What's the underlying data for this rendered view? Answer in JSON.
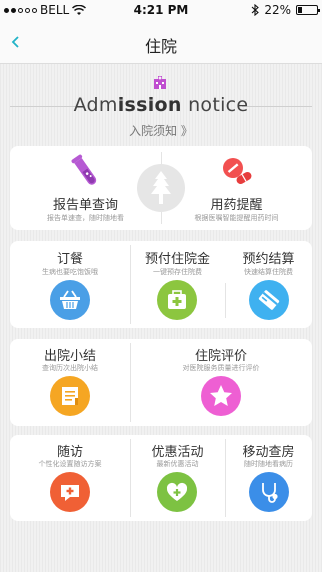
{
  "status_bar": {
    "carrier": "BELL",
    "time": "4:21 PM",
    "battery": "22%",
    "battery_level": 0.22
  },
  "nav": {
    "title": "住院"
  },
  "admission": {
    "title_light": "Adm",
    "title_bold": "ission",
    "title_tail": " notice",
    "subtitle": "入院须知 》"
  },
  "top_card": {
    "left": {
      "title": "报告单查询",
      "subtitle": "报告单速查，随时随地看"
    },
    "right": {
      "title": "用药提醒",
      "subtitle": "根据医嘱智能提醒用药时间"
    }
  },
  "row1": [
    {
      "title": "订餐",
      "subtitle": "生病也要吃饱饭哦",
      "color": "#4a9fe6",
      "icon": "basket-icon"
    },
    {
      "title": "预付住院金",
      "subtitle": "一键预存住院费",
      "color": "#8cc63f",
      "icon": "medkit-icon"
    },
    {
      "title": "预约结算",
      "subtitle": "快速结算住院费",
      "color": "#3fb1f0",
      "icon": "card-icon"
    }
  ],
  "row2": [
    {
      "title": "出院小结",
      "subtitle": "查询历次出院小结",
      "color": "#f5a623",
      "icon": "document-icon"
    },
    {
      "title": "住院评价",
      "subtitle": "对医院服务质量进行评价",
      "color": "#ee5fd3",
      "icon": "star-icon"
    }
  ],
  "row3": [
    {
      "title": "随访",
      "subtitle": "个性化设置随访方案",
      "color": "#f06035",
      "icon": "chat-plus-icon"
    },
    {
      "title": "优惠活动",
      "subtitle": "最新优惠活动",
      "color": "#7dc242",
      "icon": "heart-plus-icon"
    },
    {
      "title": "移动查房",
      "subtitle": "随时随地看病历",
      "color": "#3b8ee8",
      "icon": "stethoscope-icon"
    }
  ]
}
